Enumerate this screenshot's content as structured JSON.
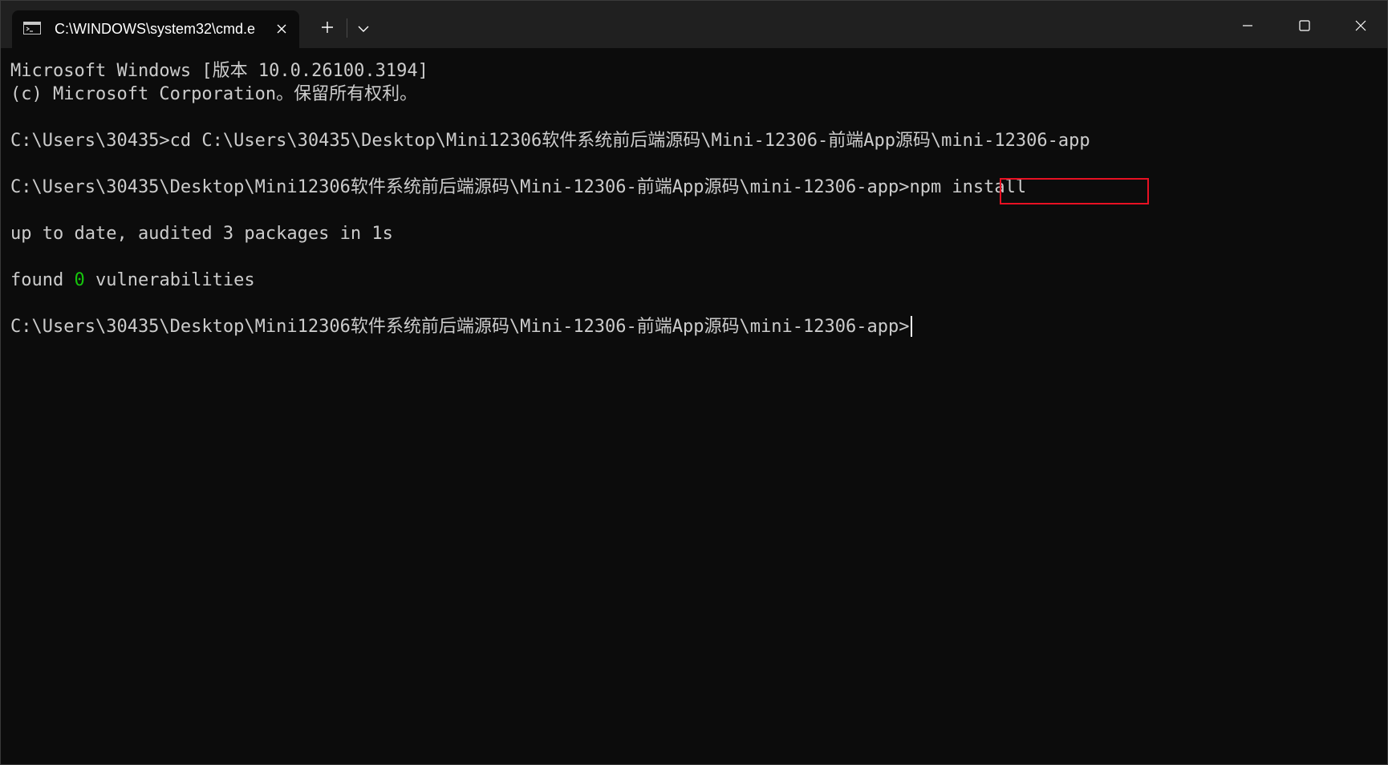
{
  "window": {
    "tab_title": "C:\\WINDOWS\\system32\\cmd.e",
    "tab_icon": "console-icon",
    "new_tab_symbol": "+",
    "colors": {
      "titlebar": "#202020",
      "terminal_bg": "#0c0c0c",
      "text": "#cccccc",
      "success": "#16c60c",
      "highlight": "#e81123"
    }
  },
  "terminal": {
    "lines": {
      "l1": "Microsoft Windows [版本 10.0.26100.3194]",
      "l2": "(c) Microsoft Corporation。保留所有权利。",
      "l3": "C:\\Users\\30435>cd C:\\Users\\30435\\Desktop\\Mini12306软件系统前后端源码\\Mini-12306-前端App源码\\mini-12306-app",
      "l4_prompt": "C:\\Users\\30435\\Desktop\\Mini12306软件系统前后端源码\\Mini-12306-前端App源码\\mini-12306-app>",
      "l4_command": "npm install",
      "l5": "up to date, audited 3 packages in 1s",
      "l6_prefix": "found ",
      "l6_count": "0",
      "l6_suffix": " vulnerabilities",
      "l7_prompt": "C:\\Users\\30435\\Desktop\\Mini12306软件系统前后端源码\\Mini-12306-前端App源码\\mini-12306-app>"
    }
  }
}
